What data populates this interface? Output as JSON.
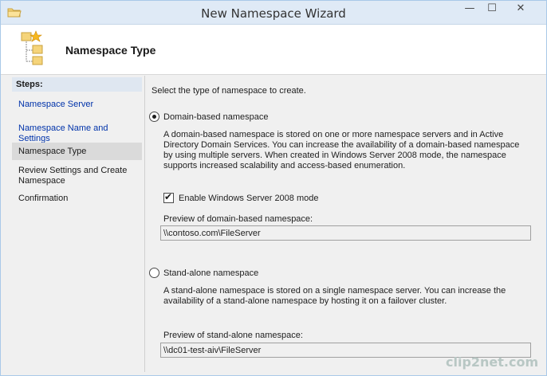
{
  "window": {
    "title": "New Namespace Wizard",
    "controls": {
      "minimize_glyph": "—",
      "maximize_glyph": "☐",
      "close_glyph": "✕"
    }
  },
  "header": {
    "title": "Namespace Type"
  },
  "steps": {
    "heading": "Steps:",
    "items": [
      {
        "label": "Namespace Server",
        "state": "link"
      },
      {
        "label": "Namespace Name and Settings",
        "state": "link"
      },
      {
        "label": "Namespace Type",
        "state": "current"
      },
      {
        "label": "Review Settings and Create Namespace",
        "state": "pending"
      },
      {
        "label": "Confirmation",
        "state": "pending"
      }
    ]
  },
  "content": {
    "prompt": "Select the type of namespace to create.",
    "domain_based": {
      "label": "Domain-based namespace",
      "selected": true,
      "description": "A domain-based namespace is stored on one or more namespace servers and in Active Directory Domain Services. You can increase the availability of a domain-based namespace by using multiple servers. When created in Windows Server 2008 mode, the namespace supports increased scalability and access-based enumeration.",
      "ws2008_mode": {
        "label": "Enable Windows Server 2008 mode",
        "checked": true,
        "tick_glyph": "✔"
      },
      "preview_label": "Preview of domain-based namespace:",
      "preview_value": "\\\\contoso.com\\FileServer"
    },
    "standalone": {
      "label": "Stand-alone namespace",
      "selected": false,
      "description": "A stand-alone namespace is stored on a single namespace server. You can increase the availability of a stand-alone namespace by hosting it on a failover cluster.",
      "preview_label": "Preview of stand-alone namespace:",
      "preview_value": "\\\\dc01-test-aiv\\FileServer"
    }
  },
  "watermark": {
    "text": "clip2net.com"
  },
  "colors": {
    "link": "#0033aa",
    "title_bar": "#dfeaf6",
    "window_bg": "#f0f0f0"
  },
  "icons": {
    "title": "folder-icon",
    "header": "namespace-tree-icon"
  }
}
